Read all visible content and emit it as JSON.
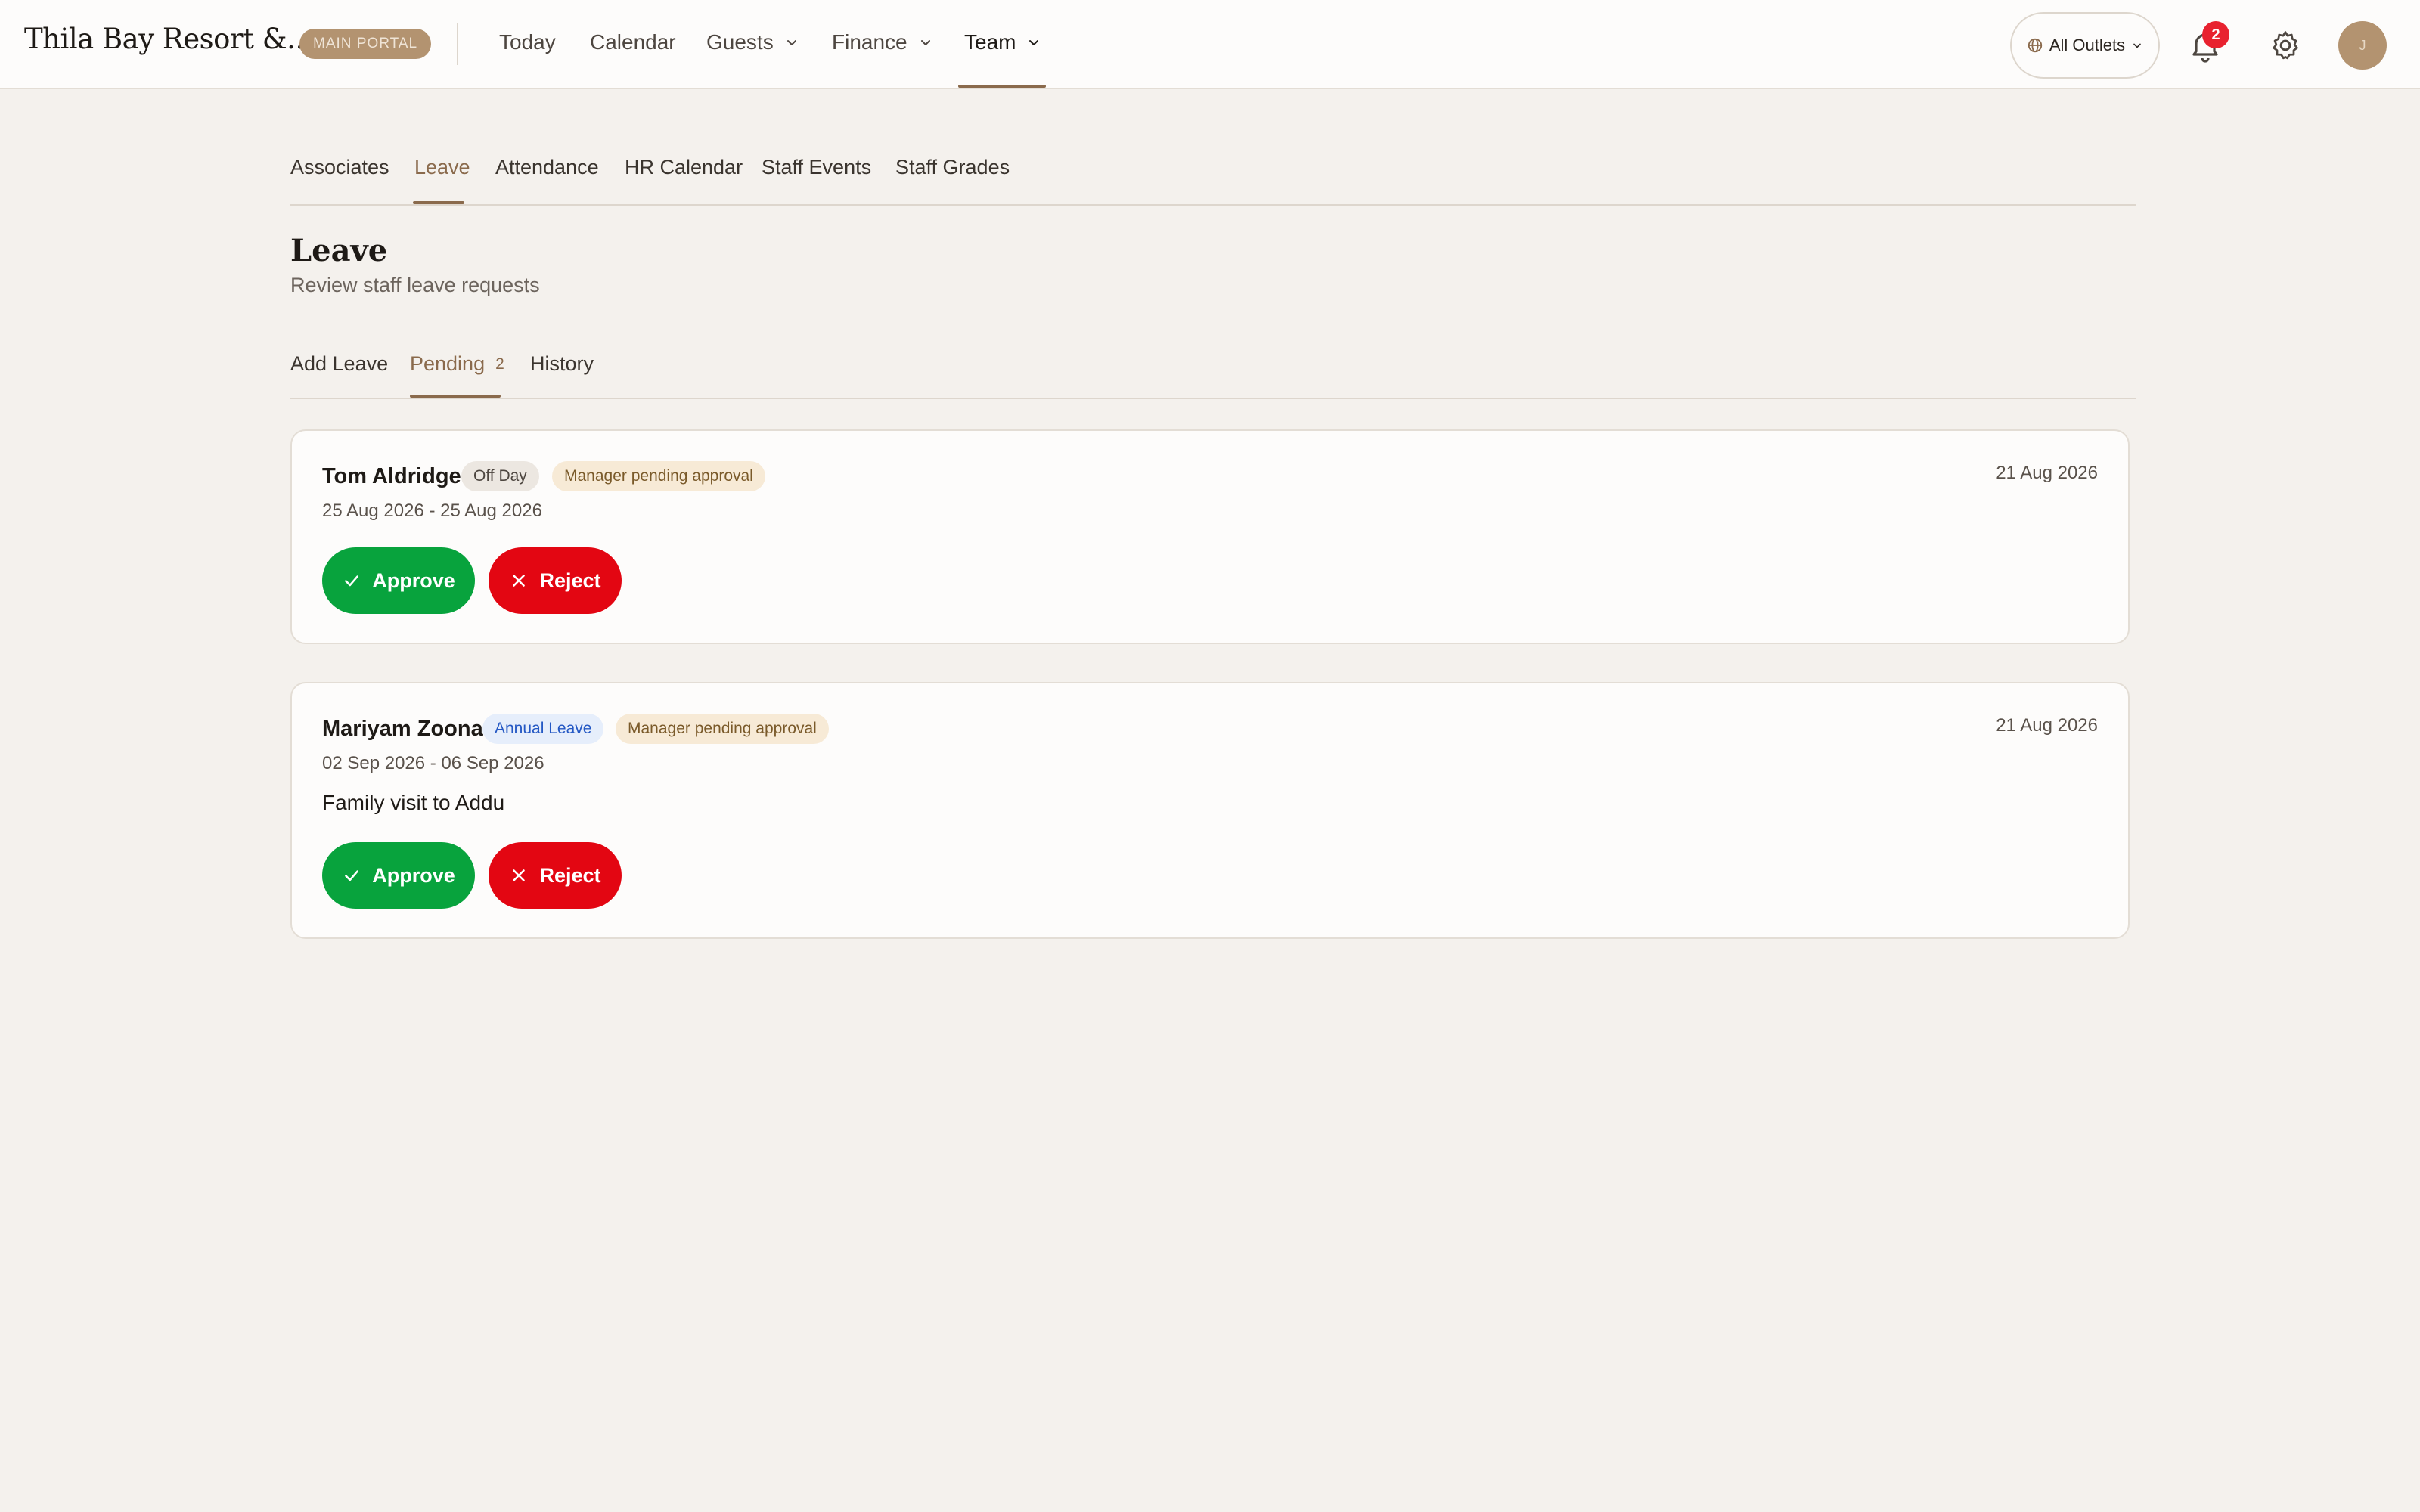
{
  "app": {
    "brand": "Thila Bay Resort &...",
    "portal_badge": "MAIN PORTAL"
  },
  "nav": {
    "items": [
      {
        "label": "Today",
        "has_dropdown": false
      },
      {
        "label": "Calendar",
        "has_dropdown": false
      },
      {
        "label": "Guests",
        "has_dropdown": true
      },
      {
        "label": "Finance",
        "has_dropdown": true
      },
      {
        "label": "Team",
        "has_dropdown": true,
        "active": true
      }
    ]
  },
  "header": {
    "outlet_selector": "All Outlets",
    "notification_count": "2",
    "avatar_initial": "J"
  },
  "section_tabs": [
    {
      "label": "Associates"
    },
    {
      "label": "Leave",
      "active": true
    },
    {
      "label": "Attendance"
    },
    {
      "label": "HR Calendar"
    },
    {
      "label": "Staff Events"
    },
    {
      "label": "Staff Grades"
    }
  ],
  "page": {
    "title": "Leave",
    "subtitle": "Review staff leave requests"
  },
  "sub_tabs": [
    {
      "label": "Add Leave"
    },
    {
      "label": "Pending",
      "count": "2",
      "active": true
    },
    {
      "label": "History"
    }
  ],
  "requests": [
    {
      "name": "Tom Aldridge",
      "leave_type": "Off Day",
      "status": "Manager pending approval",
      "date_range": "25 Aug 2026 - 25 Aug 2026",
      "submitted": "21 Aug 2026",
      "note": "",
      "approve_label": "Approve",
      "reject_label": "Reject"
    },
    {
      "name": "Mariyam Zoona",
      "leave_type": "Annual Leave",
      "status": "Manager pending approval",
      "date_range": "02 Sep 2026 - 06 Sep 2026",
      "submitted": "21 Aug 2026",
      "note": "Family visit to Addu",
      "approve_label": "Approve",
      "reject_label": "Reject"
    }
  ],
  "colors": {
    "accent": "#8a6a4c",
    "approve": "#08a33d",
    "reject": "#e30612",
    "notification": "#e8222f",
    "background": "#f4f1ed"
  }
}
